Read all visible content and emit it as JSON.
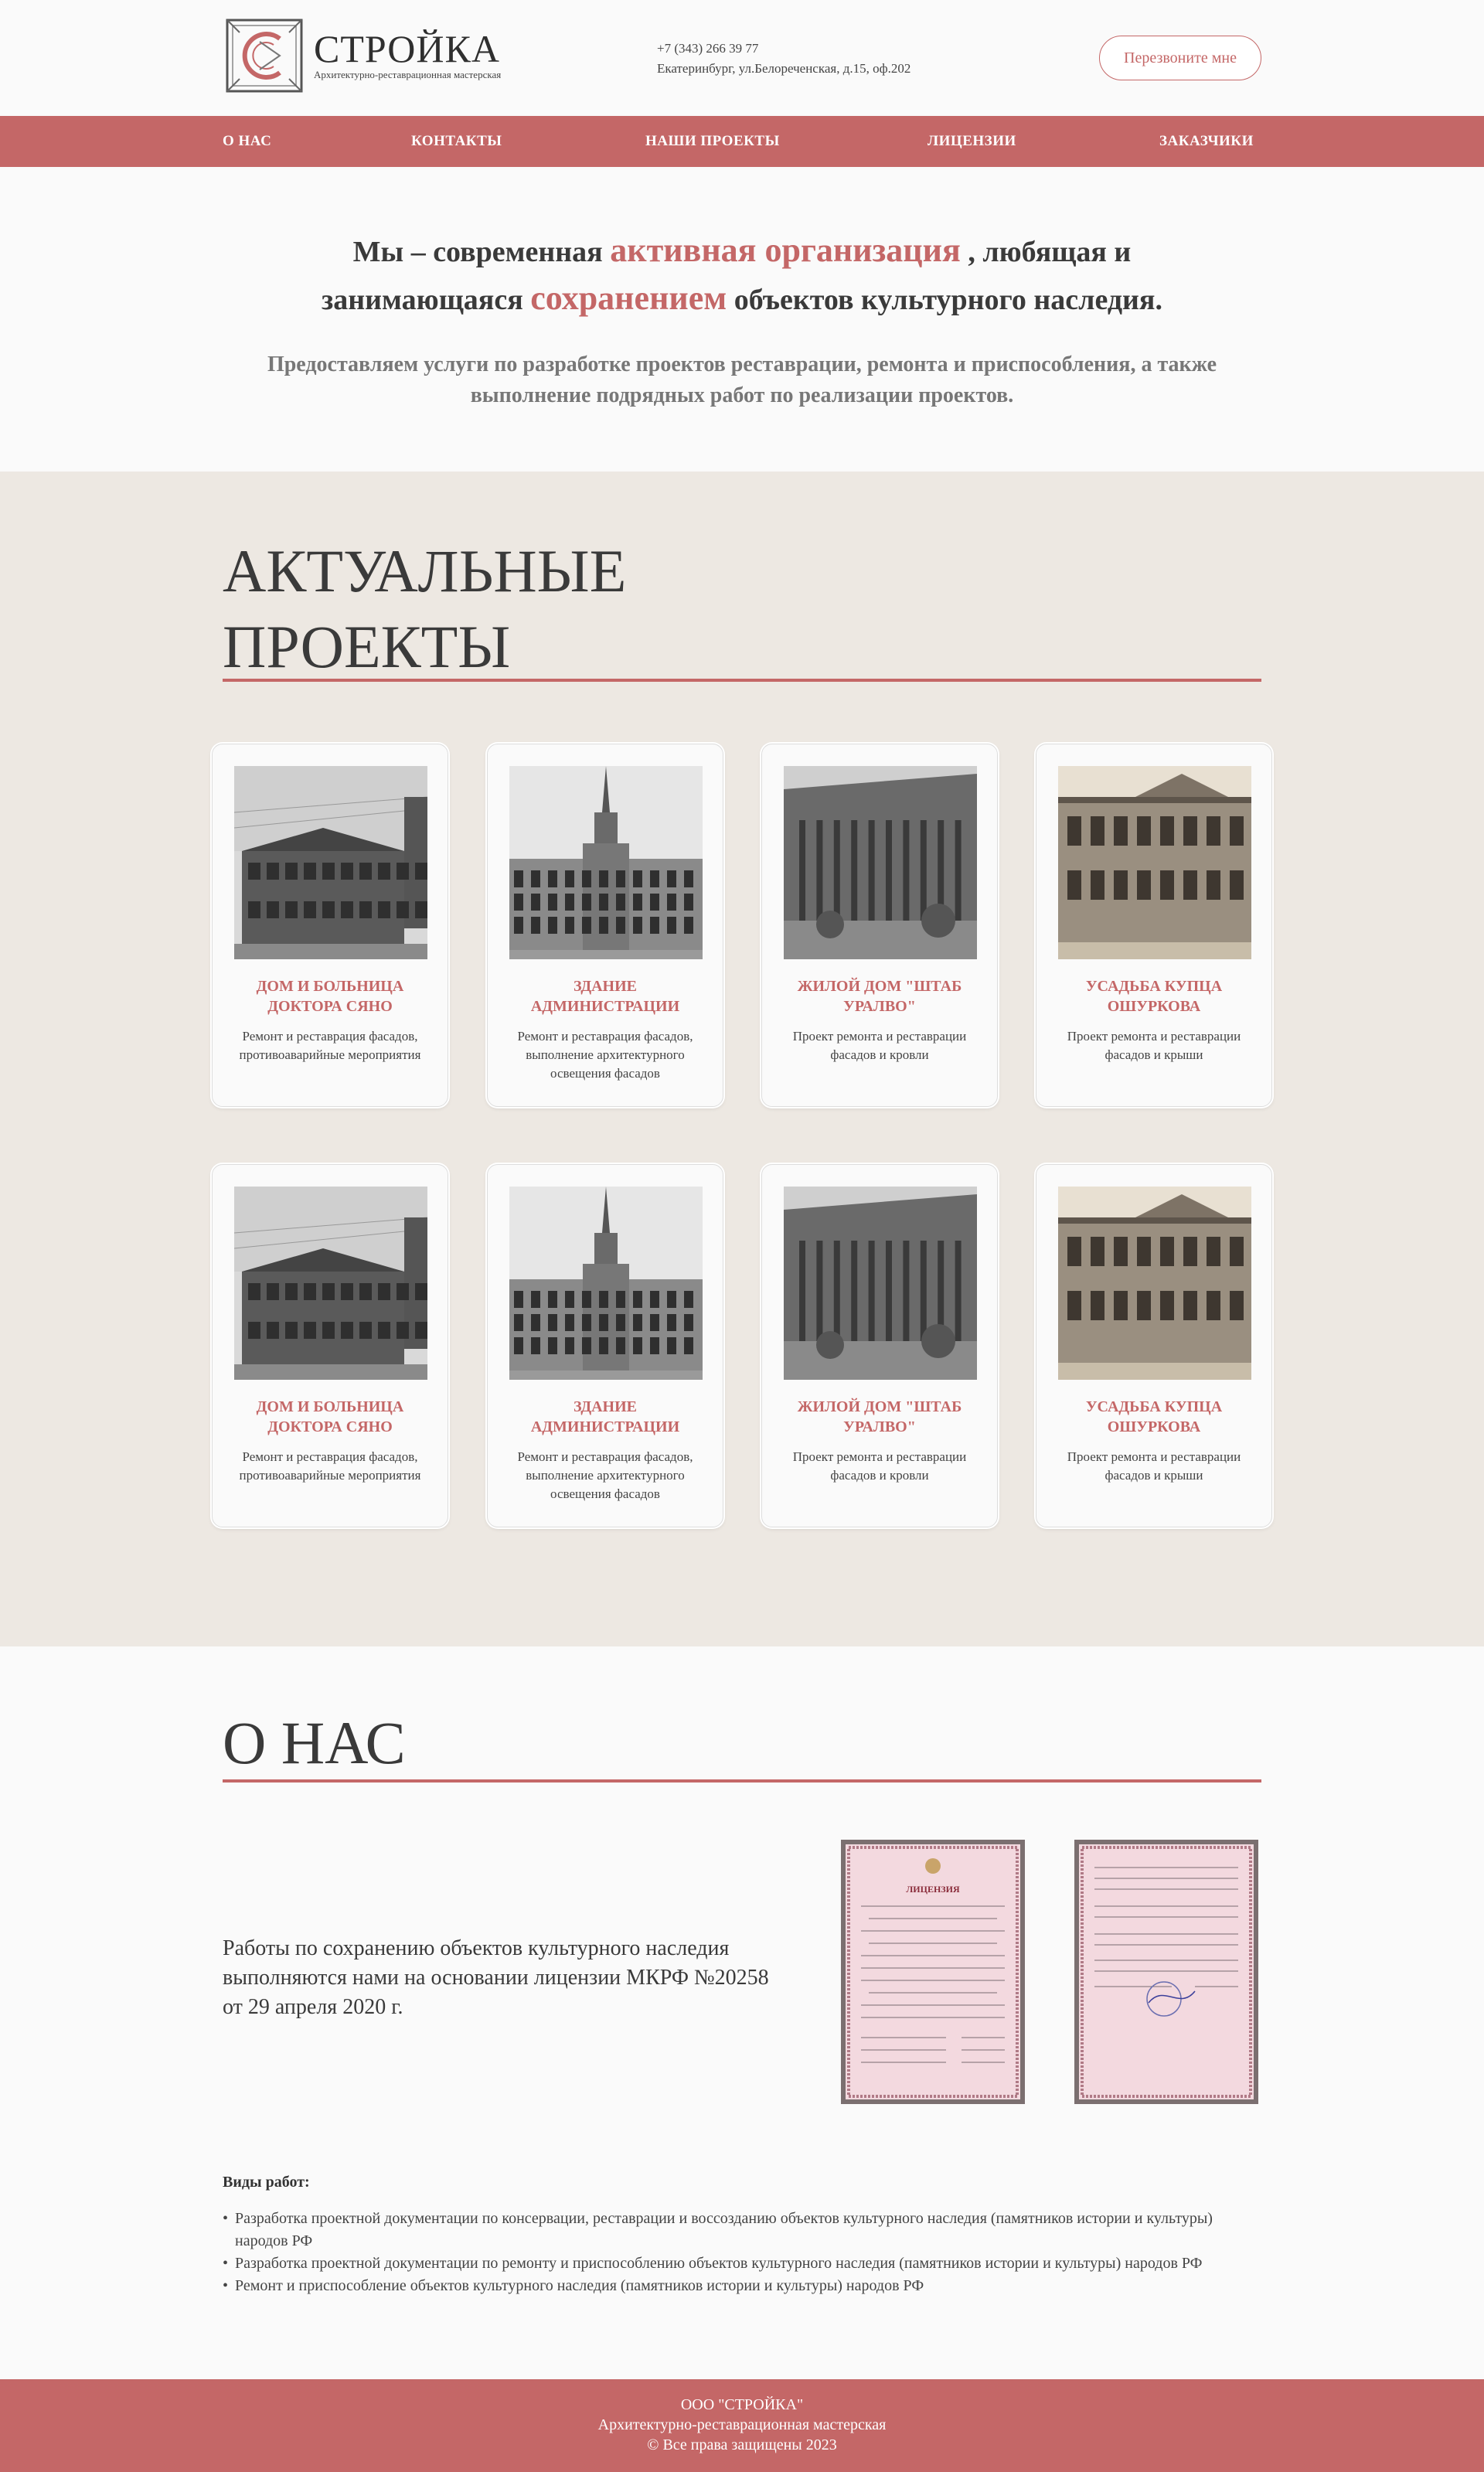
{
  "header": {
    "logo_title": "СТРОЙКА",
    "logo_subtitle": "Архитектурно-реставрационная мастерская",
    "phone": "+7 (343) 266 39 77",
    "address": "Екатеринбург, ул.Белореченская, д.15, оф.202",
    "callback_label": "Перезвоните мне"
  },
  "nav": {
    "items": [
      {
        "label": "О НАС"
      },
      {
        "label": "КОНТАКТЫ"
      },
      {
        "label": "НАШИ ПРОЕКТЫ"
      },
      {
        "label": "ЛИЦЕНЗИИ"
      },
      {
        "label": "ЗАКАЗЧИКИ"
      }
    ]
  },
  "intro": {
    "line1_a": "Мы – современная ",
    "line1_accent": "активная организация",
    "line1_b": " , любящая и",
    "line2_a": "занимающаяся ",
    "line2_accent": "сохранением",
    "line2_b": " объектов культурного наследия.",
    "subtitle": "Предоставляем услуги по разработке проектов реставрации, ремонта и приспособления, а также выполнение подрядных работ по реализации проектов."
  },
  "projects": {
    "title_line1": "АКТУАЛЬНЫЕ",
    "title_line2": "ПРОЕКТЫ",
    "cards": [
      {
        "title": "ДОМ И БОЛЬНИЦА ДОКТОРА СЯНО",
        "desc": "Ремонт и реставрация фасадов, противоаварийные мероприятия"
      },
      {
        "title": "ЗДАНИЕ АДМИНИСТРАЦИИ",
        "desc": "Ремонт и реставрация фасадов, выполнение архитектурного освещения фасадов"
      },
      {
        "title": "ЖИЛОЙ ДОМ \"ШТАБ УРАЛВО\"",
        "desc": "Проект ремонта и реставрации фасадов и кровли"
      },
      {
        "title": "УСАДЬБА КУПЦА ОШУРКОВА",
        "desc": "Проект ремонта и реставрации фасадов и крыши"
      },
      {
        "title": "ДОМ И БОЛЬНИЦА ДОКТОРА СЯНО",
        "desc": "Ремонт и реставрация фасадов, противоаварийные мероприятия"
      },
      {
        "title": "ЗДАНИЕ АДМИНИСТРАЦИИ",
        "desc": "Ремонт и реставрация фасадов, выполнение архитектурного освещения фасадов"
      },
      {
        "title": "ЖИЛОЙ ДОМ \"ШТАБ УРАЛВО\"",
        "desc": "Проект ремонта и реставрации фасадов и кровли"
      },
      {
        "title": "УСАДЬБА КУПЦА ОШУРКОВА",
        "desc": "Проект ремонта и реставрации фасадов и крыши"
      }
    ]
  },
  "about": {
    "title": "О НАС",
    "text": "Работы по сохранению объектов культурного наследия выполняются нами на основании лицензии МКРФ №20258 от 29 апреля 2020 г.",
    "license_heading": "ЛИЦЕНЗИЯ",
    "works_title": "Виды работ:",
    "works": [
      "Разработка проектной документации по консервации, реставрации и воссозданию объектов культурного наследия (памятников истории и культуры) народов РФ",
      "Разработка проектной документации по ремонту и приспособлению объектов культурного наследия (памятников истории и культуры) народов РФ",
      "Ремонт и приспособление объектов культурного наследия (памятников истории и культуры) народов РФ"
    ]
  },
  "footer": {
    "company": "ООО \"СТРОЙКА\"",
    "subtitle": "Архитектурно-реставрационная мастерская",
    "copyright": "© Все права защищены 2023"
  },
  "colors": {
    "accent": "#c46767",
    "section_bg": "#ede8e2",
    "page_bg": "#fafafa"
  }
}
